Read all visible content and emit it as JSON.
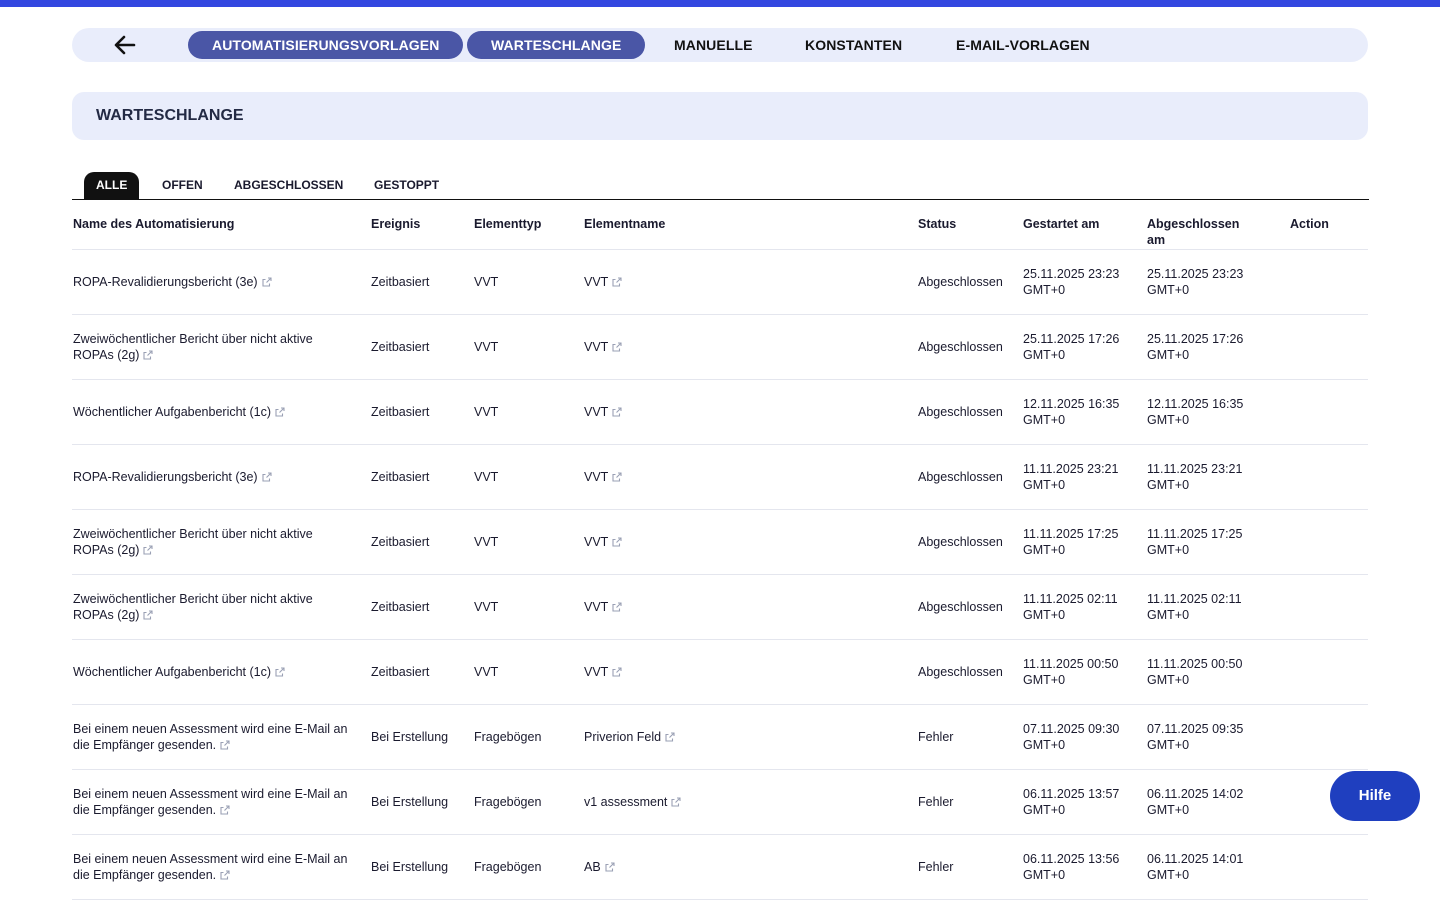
{
  "nav": {
    "back_icon": "arrow-left-icon",
    "tabs": [
      {
        "label": "AUTOMATISIERUNGSVORLAGEN",
        "active": true
      },
      {
        "label": "WARTESCHLANGE",
        "active": true
      },
      {
        "label": "MANUELLE",
        "active": false
      },
      {
        "label": "KONSTANTEN",
        "active": false
      },
      {
        "label": "E-MAIL-VORLAGEN",
        "active": false
      }
    ]
  },
  "section": {
    "title": "WARTESCHLANGE"
  },
  "filters": [
    {
      "label": "ALLE",
      "active": true
    },
    {
      "label": "OFFEN",
      "active": false
    },
    {
      "label": "ABGESCHLOSSEN",
      "active": false
    },
    {
      "label": "GESTOPPT",
      "active": false
    }
  ],
  "table": {
    "headers": {
      "name": "Name des Automatisierung",
      "event": "Ereignis",
      "type": "Elementtyp",
      "element": "Elementname",
      "status": "Status",
      "started": "Gestartet am",
      "completed_1": "Abgeschlossen",
      "completed_2": "am",
      "action": "Action"
    },
    "rows": [
      {
        "name": [
          "ROPA-Revalidierungsbericht (3e)"
        ],
        "event": "Zeitbasiert",
        "type": "VVT",
        "element": "VVT",
        "status": "Abgeschlossen",
        "started": [
          "25.11.2025 23:23",
          "GMT+0"
        ],
        "completed": [
          "25.11.2025 23:23",
          "GMT+0"
        ]
      },
      {
        "name": [
          "Zweiwöchentlicher Bericht über nicht aktive",
          "ROPAs (2g)"
        ],
        "event": "Zeitbasiert",
        "type": "VVT",
        "element": "VVT",
        "status": "Abgeschlossen",
        "started": [
          "25.11.2025 17:26",
          "GMT+0"
        ],
        "completed": [
          "25.11.2025 17:26",
          "GMT+0"
        ]
      },
      {
        "name": [
          "Wöchentlicher Aufgabenbericht (1c)"
        ],
        "event": "Zeitbasiert",
        "type": "VVT",
        "element": "VVT",
        "status": "Abgeschlossen",
        "started": [
          "12.11.2025 16:35",
          "GMT+0"
        ],
        "completed": [
          "12.11.2025 16:35",
          "GMT+0"
        ]
      },
      {
        "name": [
          "ROPA-Revalidierungsbericht (3e)"
        ],
        "event": "Zeitbasiert",
        "type": "VVT",
        "element": "VVT",
        "status": "Abgeschlossen",
        "started": [
          "11.11.2025 23:21",
          "GMT+0"
        ],
        "completed": [
          "11.11.2025 23:21",
          "GMT+0"
        ]
      },
      {
        "name": [
          "Zweiwöchentlicher Bericht über nicht aktive",
          "ROPAs (2g)"
        ],
        "event": "Zeitbasiert",
        "type": "VVT",
        "element": "VVT",
        "status": "Abgeschlossen",
        "started": [
          "11.11.2025 17:25",
          "GMT+0"
        ],
        "completed": [
          "11.11.2025 17:25",
          "GMT+0"
        ]
      },
      {
        "name": [
          "Zweiwöchentlicher Bericht über nicht aktive",
          "ROPAs (2g)"
        ],
        "event": "Zeitbasiert",
        "type": "VVT",
        "element": "VVT",
        "status": "Abgeschlossen",
        "started": [
          "11.11.2025 02:11",
          "GMT+0"
        ],
        "completed": [
          "11.11.2025 02:11",
          "GMT+0"
        ]
      },
      {
        "name": [
          "Wöchentlicher Aufgabenbericht (1c)"
        ],
        "event": "Zeitbasiert",
        "type": "VVT",
        "element": "VVT",
        "status": "Abgeschlossen",
        "started": [
          "11.11.2025 00:50",
          "GMT+0"
        ],
        "completed": [
          "11.11.2025 00:50",
          "GMT+0"
        ]
      },
      {
        "name": [
          "Bei einem neuen Assessment wird eine E-Mail an",
          "die Empfänger gesenden."
        ],
        "event": "Bei Erstellung",
        "type": "Fragebögen",
        "element": "Priverion Feld",
        "status": "Fehler",
        "started": [
          "07.11.2025 09:30",
          "GMT+0"
        ],
        "completed": [
          "07.11.2025 09:35",
          "GMT+0"
        ]
      },
      {
        "name": [
          "Bei einem neuen Assessment wird eine E-Mail an",
          "die Empfänger gesenden."
        ],
        "event": "Bei Erstellung",
        "type": "Fragebögen",
        "element": "v1 assessment",
        "status": "Fehler",
        "started": [
          "06.11.2025 13:57",
          "GMT+0"
        ],
        "completed": [
          "06.11.2025 14:02",
          "GMT+0"
        ]
      },
      {
        "name": [
          "Bei einem neuen Assessment wird eine E-Mail an",
          "die Empfänger gesenden."
        ],
        "event": "Bei Erstellung",
        "type": "Fragebögen",
        "element": "AB",
        "status": "Fehler",
        "started": [
          "06.11.2025 13:56",
          "GMT+0"
        ],
        "completed": [
          "06.11.2025 14:01",
          "GMT+0"
        ]
      }
    ]
  },
  "help_button": {
    "label": "Hilfe"
  },
  "colors": {
    "accent": "#3347e0",
    "active_tab": "#4a56a6",
    "nav_bg": "#e9edfb",
    "help_bg": "#1f3fbf"
  },
  "icons": {
    "external_link": "external-link-icon"
  }
}
